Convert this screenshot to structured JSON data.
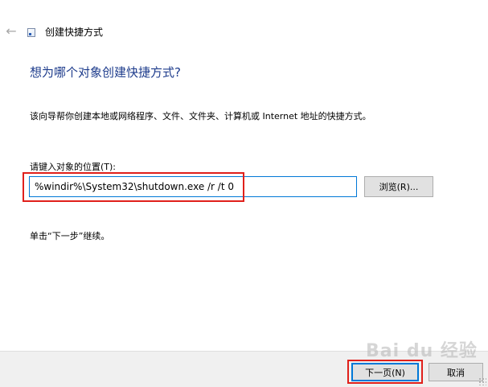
{
  "window": {
    "title": "创建快捷方式"
  },
  "icons": {
    "back": "back-arrow-icon",
    "app": "shortcut-wizard-icon"
  },
  "wizard": {
    "heading": "想为哪个对象创建快捷方式?",
    "description": "该向导帮你创建本地或网络程序、文件、文件夹、计算机或 Internet 地址的快捷方式。",
    "location_label": "请键入对象的位置(T):",
    "location_value": "%windir%\\System32\\shutdown.exe /r /t 0",
    "browse_label": "浏览(R)...",
    "instruction": "单击“下一步”继续。"
  },
  "footer": {
    "next_label": "下一页(N)",
    "cancel_label": "取消"
  },
  "colors": {
    "heading": "#1e3c8c",
    "highlight": "#e0201b",
    "focus": "#0078d7",
    "footer_bg": "#f0f0f0"
  },
  "watermark": "Bai du 经验"
}
